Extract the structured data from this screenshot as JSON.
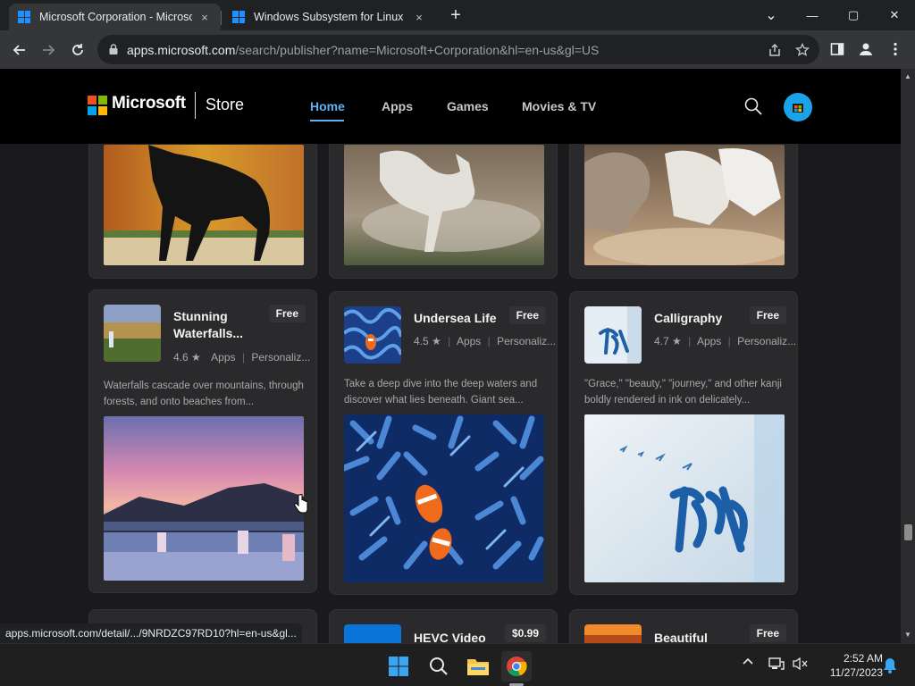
{
  "browser": {
    "tabs": [
      {
        "title": "Microsoft Corporation - Microsoft Store",
        "close": "×",
        "active": true
      },
      {
        "title": "Windows Subsystem for Linux - Microsoft Store",
        "close": "×",
        "active": false
      }
    ],
    "new_tab": "+",
    "window_controls": {
      "minimize": "—",
      "maximize": "▢",
      "close": "✕",
      "tab_search": "⌄"
    },
    "url_host": "apps.microsoft.com",
    "url_path": "/search/publisher?name=Microsoft+Corporation&hl=en-us&gl=US",
    "status_url": "apps.microsoft.com/detail/.../9NRDZC97RD10?hl=en-us&gl..."
  },
  "store": {
    "brand": "Microsoft",
    "product": "Store",
    "nav": [
      {
        "label": "Home",
        "active": true
      },
      {
        "label": "Apps",
        "active": false
      },
      {
        "label": "Games",
        "active": false
      },
      {
        "label": "Movies & TV",
        "active": false
      }
    ]
  },
  "cards": [
    {
      "title": "Stunning Waterfalls...",
      "price": "Free",
      "rating": "4.6",
      "category": "Apps",
      "subcategory": "Personaliz...",
      "description": "Waterfalls cascade over mountains, through forests, and onto beaches from..."
    },
    {
      "title": "Undersea Life",
      "price": "Free",
      "rating": "4.5",
      "category": "Apps",
      "subcategory": "Personaliz...",
      "description": "Take a deep dive into the deep waters and discover what lies beneath. Giant sea..."
    },
    {
      "title": "Calligraphy",
      "price": "Free",
      "rating": "4.7",
      "category": "Apps",
      "subcategory": "Personaliz...",
      "description": "\"Grace,\" \"beauty,\" \"journey,\" and other kanji boldly rendered in ink on delicately..."
    }
  ],
  "bottom_cards": [
    {
      "title": "HEVC Video",
      "price": "$0.99"
    },
    {
      "title": "Beautiful",
      "price": "Free"
    }
  ],
  "taskbar": {
    "time": "2:52 AM",
    "date": "11/27/2023"
  },
  "colors": {
    "accent": "#5fb2f3",
    "header_bg": "#000000",
    "card_bg": "#2a2a2c"
  }
}
